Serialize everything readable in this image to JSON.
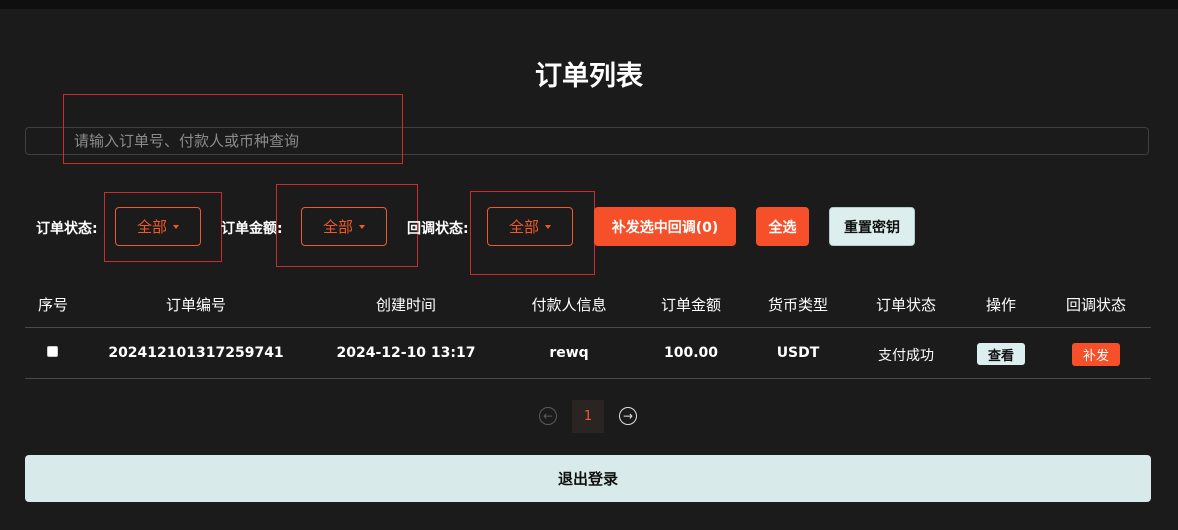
{
  "page": {
    "title": "订单列表"
  },
  "search": {
    "placeholder": "请输入订单号、付款人或币种查询",
    "value": ""
  },
  "filters": {
    "order_status": {
      "label": "订单状态:",
      "value": "全部"
    },
    "order_amount": {
      "label": "订单金额:",
      "value": "全部"
    },
    "callback_status": {
      "label": "回调状态:",
      "value": "全部"
    }
  },
  "actions": {
    "reissue_selected": "补发选中回调(0)",
    "select_all": "全选",
    "reset_key": "重置密钥"
  },
  "table": {
    "headers": [
      "序号",
      "订单编号",
      "创建时间",
      "付款人信息",
      "订单金额",
      "货币类型",
      "订单状态",
      "操作",
      "回调状态"
    ],
    "rows": [
      {
        "checked": false,
        "order_no": "202412101317259741",
        "created_at": "2024-12-10 13:17",
        "payer": "rewq",
        "amount": "100.00",
        "currency": "USDT",
        "status": "支付成功",
        "action": "查看",
        "callback": "补发"
      }
    ]
  },
  "pagination": {
    "current_page": "1"
  },
  "logout": {
    "label": "退出登录"
  },
  "colors": {
    "accent": "#f5502a",
    "background": "#1b1b1b",
    "light_button": "#ddeeee"
  }
}
